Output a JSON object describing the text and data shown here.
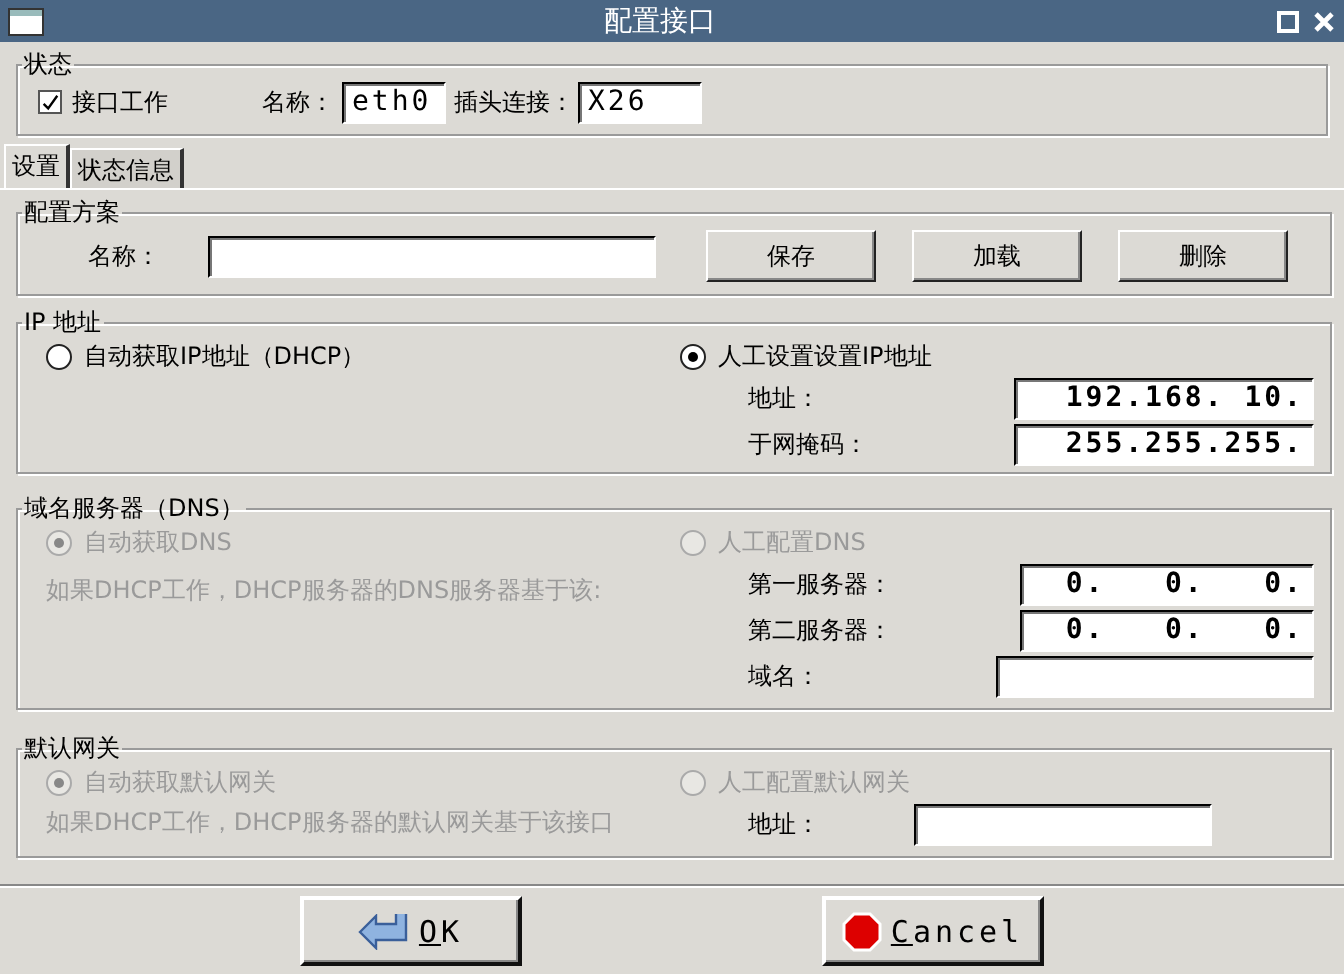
{
  "window": {
    "title": "配置接口"
  },
  "status": {
    "title": "状态",
    "interface_working": {
      "label": "接口工作",
      "checked": true
    },
    "name": {
      "label": "名称：",
      "value": "eth0"
    },
    "connector": {
      "label": "插头连接：",
      "value": "X26"
    }
  },
  "tabs": [
    {
      "label": "设置",
      "selected": true
    },
    {
      "label": "状态信息",
      "selected": false
    }
  ],
  "profile": {
    "title": "配置方案",
    "name_label": "名称：",
    "buttons": [
      "保存",
      "加载",
      "删除"
    ]
  },
  "ip": {
    "title": "IP 地址",
    "options": [
      {
        "label": "自动获取IP地址（DHCP）",
        "selected": false,
        "disabled": false
      },
      {
        "label": "人工设置设置IP地址",
        "selected": true,
        "disabled": false
      }
    ],
    "fields": [
      {
        "label": "地址：",
        "value": "192.168. 10."
      },
      {
        "label": "于网掩码：",
        "value": "255.255.255."
      }
    ]
  },
  "dns": {
    "title": "域名服务器（DNS）",
    "options": [
      {
        "label": "自动获取DNS",
        "selected": true,
        "disabled": true
      },
      {
        "label": "人工配置DNS",
        "selected": false,
        "disabled": true
      }
    ],
    "note": "如果DHCP工作，DHCP服务器的DNS服务器基于该:",
    "fields": [
      {
        "label": "第一服务器：",
        "value": "0.   0.   0."
      },
      {
        "label": "第二服务器：",
        "value": "0.   0.   0."
      },
      {
        "label": "域名："
      }
    ]
  },
  "gateway": {
    "title": "默认网关",
    "options": [
      {
        "label": "自动获取默认网关",
        "selected": true,
        "disabled": true
      },
      {
        "label": "人工配置默认网关",
        "selected": false,
        "disabled": true
      }
    ],
    "note": "如果DHCP工作，DHCP服务器的默认网关基于该接口",
    "fields": [
      {
        "label": "地址："
      }
    ]
  },
  "buttons": [
    {
      "kind": "ok",
      "label": "OK"
    },
    {
      "kind": "cancel",
      "label": "Cancel"
    }
  ]
}
